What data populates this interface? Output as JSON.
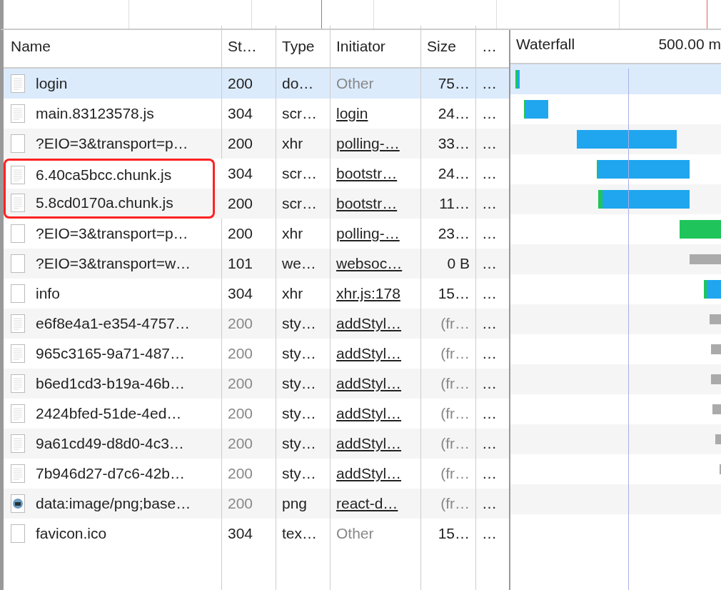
{
  "table": {
    "columns": [
      {
        "label": "Name"
      },
      {
        "label": "St…"
      },
      {
        "label": "Type"
      },
      {
        "label": "Initiator"
      },
      {
        "label": "Size"
      },
      {
        "label": "…"
      }
    ],
    "waterfall": {
      "label": "Waterfall",
      "time": "500.00 m"
    },
    "rows": [
      {
        "kind": "document",
        "name": "login",
        "status": "200",
        "status_dimmed": false,
        "type": "do…",
        "initiator": "Other",
        "initiator_link": false,
        "size": "75…",
        "size_dimmed": false,
        "more": "…",
        "selected": true,
        "boxed": false
      },
      {
        "kind": "document",
        "name": "main.83123578.js",
        "status": "304",
        "status_dimmed": false,
        "type": "scr…",
        "initiator": "login",
        "initiator_link": true,
        "size": "24…",
        "size_dimmed": false,
        "more": "…",
        "selected": false,
        "boxed": false
      },
      {
        "kind": "blank",
        "name": "?EIO=3&transport=p…",
        "status": "200",
        "status_dimmed": false,
        "type": "xhr",
        "initiator": "polling-…",
        "initiator_link": true,
        "size": "33…",
        "size_dimmed": false,
        "more": "…",
        "selected": false,
        "boxed": false
      },
      {
        "kind": "document",
        "name": "6.40ca5bcc.chunk.js",
        "status": "304",
        "status_dimmed": false,
        "type": "scr…",
        "initiator": "bootstr…",
        "initiator_link": true,
        "size": "24…",
        "size_dimmed": false,
        "more": "…",
        "selected": false,
        "boxed": true
      },
      {
        "kind": "document",
        "name": "5.8cd0170a.chunk.js",
        "status": "200",
        "status_dimmed": false,
        "type": "scr…",
        "initiator": "bootstr…",
        "initiator_link": true,
        "size": "11…",
        "size_dimmed": false,
        "more": "…",
        "selected": false,
        "boxed": true
      },
      {
        "kind": "blank",
        "name": "?EIO=3&transport=p…",
        "status": "200",
        "status_dimmed": false,
        "type": "xhr",
        "initiator": "polling-…",
        "initiator_link": true,
        "size": "23…",
        "size_dimmed": false,
        "more": "…",
        "selected": false,
        "boxed": false
      },
      {
        "kind": "blank",
        "name": "?EIO=3&transport=w…",
        "status": "101",
        "status_dimmed": false,
        "type": "we…",
        "initiator": "websoc…",
        "initiator_link": true,
        "size": "0 B",
        "size_dimmed": false,
        "more": "…",
        "selected": false,
        "boxed": false
      },
      {
        "kind": "blank",
        "name": "info",
        "status": "304",
        "status_dimmed": false,
        "type": "xhr",
        "initiator": "xhr.js:178",
        "initiator_link": true,
        "size": "15…",
        "size_dimmed": false,
        "more": "…",
        "selected": false,
        "boxed": false
      },
      {
        "kind": "document",
        "name": "e6f8e4a1-e354-4757…",
        "status": "200",
        "status_dimmed": true,
        "type": "sty…",
        "initiator": "addStyl…",
        "initiator_link": true,
        "size": "(fr…",
        "size_dimmed": true,
        "more": "…",
        "selected": false,
        "boxed": false
      },
      {
        "kind": "document",
        "name": "965c3165-9a71-487…",
        "status": "200",
        "status_dimmed": true,
        "type": "sty…",
        "initiator": "addStyl…",
        "initiator_link": true,
        "size": "(fr…",
        "size_dimmed": true,
        "more": "…",
        "selected": false,
        "boxed": false
      },
      {
        "kind": "document",
        "name": "b6ed1cd3-b19a-46b…",
        "status": "200",
        "status_dimmed": true,
        "type": "sty…",
        "initiator": "addStyl…",
        "initiator_link": true,
        "size": "(fr…",
        "size_dimmed": true,
        "more": "…",
        "selected": false,
        "boxed": false
      },
      {
        "kind": "document",
        "name": "2424bfed-51de-4ed…",
        "status": "200",
        "status_dimmed": true,
        "type": "sty…",
        "initiator": "addStyl…",
        "initiator_link": true,
        "size": "(fr…",
        "size_dimmed": true,
        "more": "…",
        "selected": false,
        "boxed": false
      },
      {
        "kind": "document",
        "name": "9a61cd49-d8d0-4c3…",
        "status": "200",
        "status_dimmed": true,
        "type": "sty…",
        "initiator": "addStyl…",
        "initiator_link": true,
        "size": "(fr…",
        "size_dimmed": true,
        "more": "…",
        "selected": false,
        "boxed": false
      },
      {
        "kind": "document",
        "name": "7b946d27-d7c6-42b…",
        "status": "200",
        "status_dimmed": true,
        "type": "sty…",
        "initiator": "addStyl…",
        "initiator_link": true,
        "size": "(fr…",
        "size_dimmed": true,
        "more": "…",
        "selected": false,
        "boxed": false
      },
      {
        "kind": "image",
        "name": "data:image/png;base…",
        "status": "200",
        "status_dimmed": true,
        "type": "png",
        "initiator": "react-d…",
        "initiator_link": true,
        "size": "(fr…",
        "size_dimmed": true,
        "more": "…",
        "selected": false,
        "boxed": false
      },
      {
        "kind": "blank",
        "name": "favicon.ico",
        "status": "304",
        "status_dimmed": false,
        "type": "tex…",
        "initiator": "Other",
        "initiator_link": false,
        "size": "15…",
        "size_dimmed": false,
        "more": "…",
        "selected": false,
        "boxed": false
      }
    ]
  }
}
